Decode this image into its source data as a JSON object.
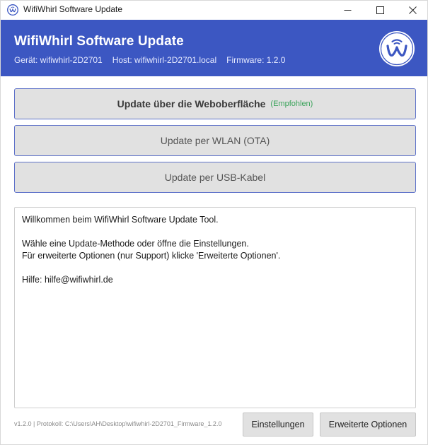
{
  "window": {
    "title": "WifiWhirl Software Update",
    "app_icon": "wifiwhirl-logo-icon",
    "controls": [
      "minimize-icon",
      "maximize-icon",
      "close-icon"
    ]
  },
  "header": {
    "title": "WifiWhirl Software Update",
    "device": "Gerät: wifiwhirl-2D2701",
    "host": "Host: wifiwhirl-2D2701.local",
    "firmware": "Firmware: 1.2.0",
    "logo": "wifiwhirl-logo-icon",
    "background_color": "#3c57c2"
  },
  "methods": {
    "web": {
      "label": "Update über die Weboberfläche",
      "badge": "(Empfohlen)"
    },
    "ota": {
      "label": "Update per WLAN (OTA)"
    },
    "usb": {
      "label": "Update per USB-Kabel"
    }
  },
  "log": {
    "lines": [
      "Willkommen beim WifiWhirl Software Update Tool.",
      "",
      "Wähle eine Update-Methode oder öffne die Einstellungen.",
      "Für erweiterte Optionen (nur Support) klicke 'Erweiterte Optionen'.",
      "",
      "Hilfe: hilfe@wifiwhirl.de"
    ]
  },
  "footer": {
    "status": "v1.2.0  |  Protokoll: C:\\Users\\AH\\Desktop\\wifiwhirl-2D2701_Firmware_1.2.0",
    "settings_label": "Einstellungen",
    "advanced_label": "Erweiterte Optionen"
  },
  "colors": {
    "accent": "#3c57c2",
    "recommended": "#3aa35a",
    "button_bg": "#e1e1e1"
  }
}
